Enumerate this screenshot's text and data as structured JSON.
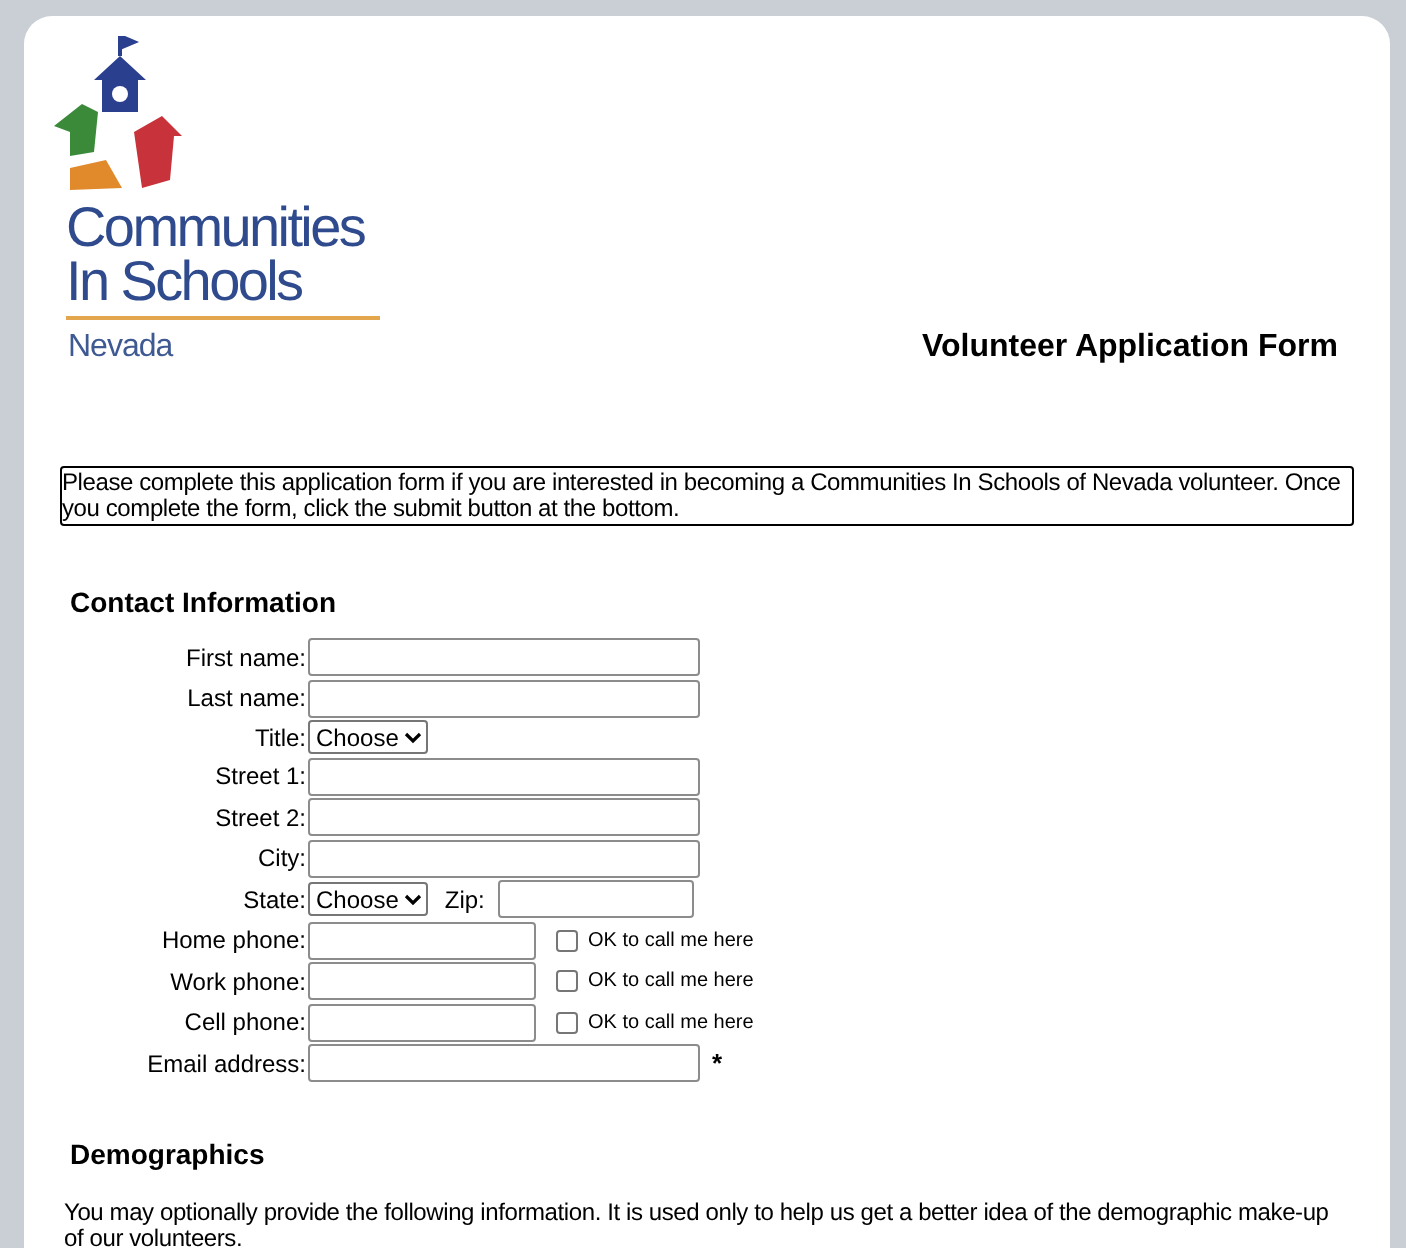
{
  "logo": {
    "line_1": "Communities",
    "line_2": "In Schools",
    "region": "Nevada"
  },
  "title": "Volunteer Application Form",
  "intro": "Please complete this application form if you are interested in becoming a Communities In Schools of Nevada volunteer. Once you complete the form, click the submit button at the bottom.",
  "contact": {
    "heading": "Contact Information",
    "fields": [
      {
        "kind": "text",
        "label": "First name:"
      },
      {
        "kind": "text",
        "label": "Last name:"
      },
      {
        "kind": "select",
        "label": "Title:",
        "value": "Choose"
      },
      {
        "kind": "text",
        "label": "Street 1:"
      },
      {
        "kind": "text",
        "label": "Street 2:"
      },
      {
        "kind": "text",
        "label": "City:"
      },
      {
        "kind": "select-zip",
        "label": "State:",
        "value": "Choose",
        "zip_label": "Zip:"
      },
      {
        "kind": "phone",
        "label": "Home phone:",
        "checkbox_label": "OK to call me here",
        "checked": false
      },
      {
        "kind": "phone",
        "label": "Work phone:",
        "checkbox_label": "OK to call me here",
        "checked": false
      },
      {
        "kind": "phone",
        "label": "Cell phone:",
        "checkbox_label": "OK to call me here",
        "checked": false
      },
      {
        "kind": "email",
        "label": "Email address:",
        "required_mark": "*"
      }
    ]
  },
  "demographics": {
    "heading": "Demographics",
    "text": "You may optionally provide the following information. It is used only to help us get a better idea of the demographic make-up of our volunteers."
  }
}
